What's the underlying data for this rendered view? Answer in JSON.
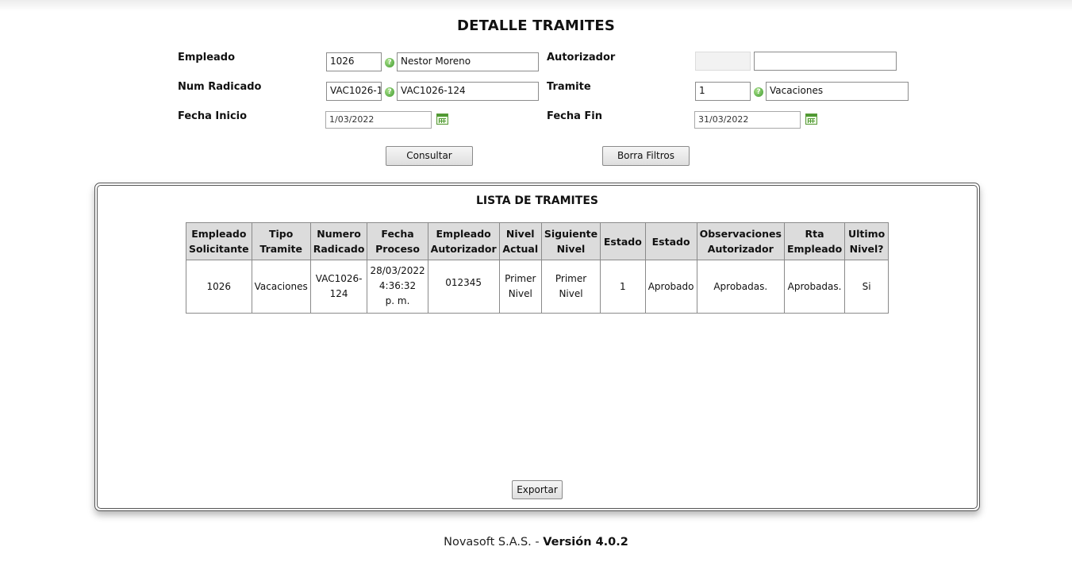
{
  "page": {
    "title": "DETALLE TRAMITES"
  },
  "filters": {
    "empleado": {
      "label": "Empleado",
      "code": "1026",
      "name": "Nestor  Moreno"
    },
    "autorizador": {
      "label": "Autorizador",
      "code": "",
      "name": ""
    },
    "num_radicado": {
      "label": "Num Radicado",
      "code": "VAC1026-1",
      "name": "VAC1026-124"
    },
    "tramite": {
      "label": "Tramite",
      "code": "1",
      "name": "Vacaciones"
    },
    "fecha_inicio": {
      "label": "Fecha Inicio",
      "value": "1/03/2022"
    },
    "fecha_fin": {
      "label": "Fecha Fin",
      "value": "31/03/2022"
    },
    "help_icon": "question-icon",
    "calendar_icon": "calendar-icon"
  },
  "buttons": {
    "consultar": "Consultar",
    "borra_filtros": "Borra Filtros",
    "exportar": "Exportar"
  },
  "list": {
    "title": "LISTA DE TRAMITES",
    "headers": [
      [
        "Empleado",
        "Solicitante"
      ],
      [
        "Tipo",
        "Tramite"
      ],
      [
        "Numero",
        "Radicado"
      ],
      [
        "Fecha",
        "Proceso"
      ],
      [
        "Empleado",
        "Autorizador"
      ],
      [
        "Nivel",
        "Actual"
      ],
      [
        "Siguiente",
        "Nivel"
      ],
      [
        "Estado"
      ],
      [
        "Estado"
      ],
      [
        "Observaciones",
        "Autorizador"
      ],
      [
        "Rta",
        "Empleado"
      ],
      [
        "Ultimo",
        "Nivel?"
      ]
    ],
    "rows": [
      {
        "cells": [
          [
            "1026"
          ],
          [
            "Vacaciones"
          ],
          [
            "VAC1026-",
            "124"
          ],
          [
            "28/03/2022",
            "4:36:32",
            "p. m."
          ],
          [
            "012345"
          ],
          [
            "Primer",
            "Nivel"
          ],
          [
            "Primer",
            "Nivel"
          ],
          [
            "1"
          ],
          [
            "Aprobado"
          ],
          [
            "Aprobadas."
          ],
          [
            "Aprobadas."
          ],
          [
            "Si"
          ]
        ]
      }
    ]
  },
  "footer": {
    "company": "Novasoft S.A.S. - ",
    "version": "Versión 4.0.2"
  },
  "colors": {
    "header_bg": "#dcdcdc",
    "icon_green": "#3f9a2e",
    "border": "#555555"
  }
}
